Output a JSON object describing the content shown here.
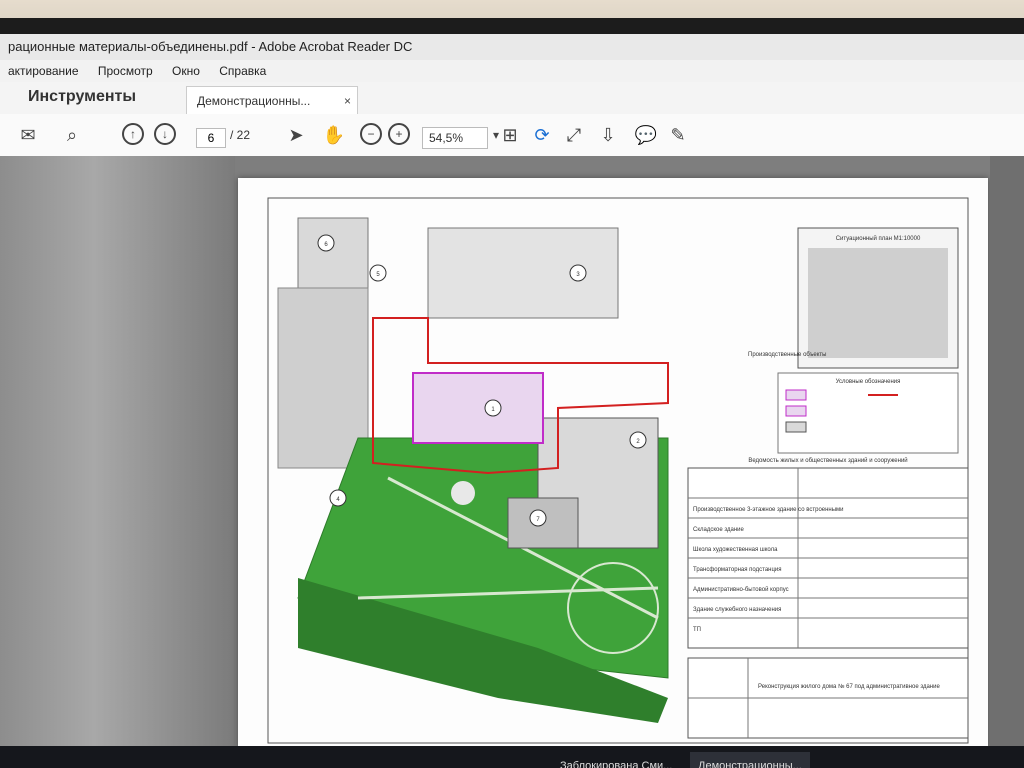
{
  "window": {
    "title": "рационные материалы-объединены.pdf - Adobe Acrobat Reader DC"
  },
  "menu": [
    "актирование",
    "Просмотр",
    "Окно",
    "Справка"
  ],
  "tabs": {
    "tools_label": "Инструменты",
    "document_label": "Демонстрационны...",
    "close_glyph": "×"
  },
  "toolbar": {
    "page_current": "6",
    "page_total": "/ 22",
    "zoom": "54,5%"
  },
  "drawing": {
    "situation_plan_title": "Ситуационный план М1:10000",
    "production_buildings_label": "Производственные объекты",
    "legend_title": "Условные обозначения",
    "building_labels": [
      "1",
      "2",
      "3",
      "4",
      "5",
      "6",
      "7"
    ],
    "table_header": "Ведомость жилых и общественных зданий и сооружений",
    "table_rows": [
      "Производственное 3-этажное здание со встроенными",
      "Складское здание",
      "Школа художественная школа",
      "Трансформаторная подстанция",
      "Административно-бытовой корпус",
      "Здание служебного назначения",
      "ТП"
    ],
    "stamp_text": "Реконструкция жилого дома № 67 под административное здание"
  },
  "taskbar": {
    "items": [
      "Заблокирована Сми...",
      "Демонстрационны..."
    ]
  },
  "colors": {
    "accent": "#c8102e",
    "green_area": "#3fa33a",
    "magenta_outline": "#c02cc8",
    "red_outline": "#d32020"
  }
}
